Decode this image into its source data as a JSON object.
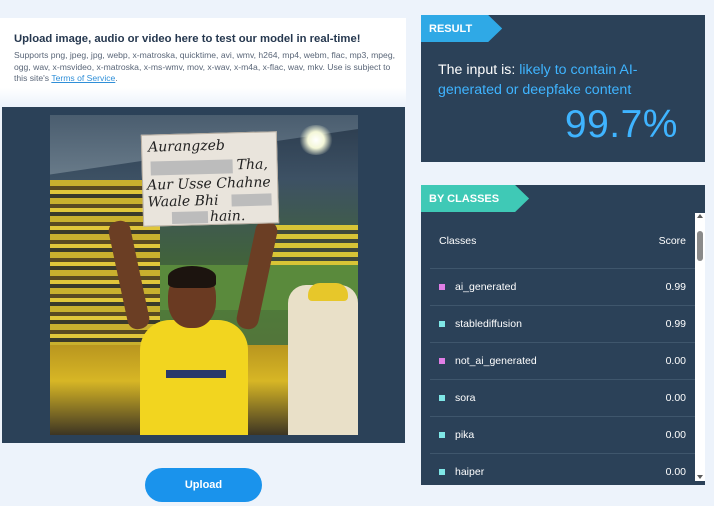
{
  "upload": {
    "heading": "Upload image, audio or video here to test our model in real-time!",
    "formats": "Supports png, jpeg, jpg, webp, x-matroska, quicktime, avi, wmv, h264, mp4, webm, flac, mp3, mpeg, ogg, wav, x-msvideo, x-matroska, x-ms-wmv, mov, x-wav, x-m4a, x-flac, wav, mkv. Use is subject to this site's",
    "terms_link": "Terms of Service",
    "terms_suffix": ".",
    "button_label": "Upload",
    "preview_sign": {
      "line1": "Aurangzeb",
      "line2": "Tha,",
      "line3": "Aur Usse Chahne",
      "line4": "Waale Bhi",
      "line5": "hain."
    }
  },
  "result": {
    "tag": "RESULT",
    "prefix": "The input is: ",
    "verdict": "likely to contain AI-generated or deepfake content",
    "score": "99.7%",
    "accent_color": "#3fb4ff"
  },
  "classes": {
    "tag": "BY CLASSES",
    "header": {
      "name": "Classes",
      "score": "Score"
    },
    "rows": [
      {
        "name": "ai_generated",
        "score": "0.99",
        "color": "#e07ee6"
      },
      {
        "name": "stablediffusion",
        "score": "0.99",
        "color": "#7fe7e7"
      },
      {
        "name": "not_ai_generated",
        "score": "0.00",
        "color": "#e07ee6"
      },
      {
        "name": "sora",
        "score": "0.00",
        "color": "#7fe7e7"
      },
      {
        "name": "pika",
        "score": "0.00",
        "color": "#7fe7e7"
      },
      {
        "name": "haiper",
        "score": "0.00",
        "color": "#7fe7e7"
      }
    ]
  }
}
